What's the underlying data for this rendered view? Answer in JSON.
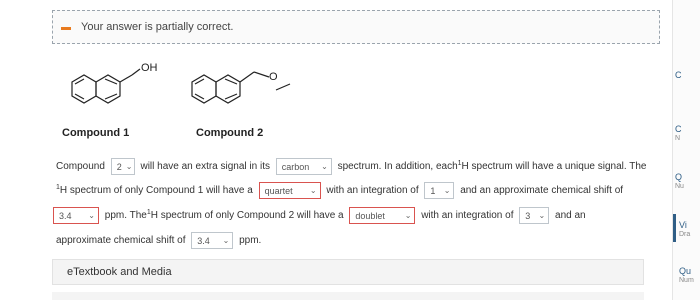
{
  "banner": {
    "message": "Your answer is partially correct."
  },
  "compounds": [
    {
      "label": "Compound 1",
      "substituent": "OH"
    },
    {
      "label": "Compound 2",
      "substituent": "O"
    }
  ],
  "question": {
    "line1_pre": "Compound",
    "compound_select": "2",
    "line1_mid": "will have an extra signal in its",
    "spectrum_select": "carbon",
    "line1_post": "spectrum. In addition, each",
    "h1_sup": "1",
    "line1_end": "H spectrum will have a unique signal. The",
    "line2_pre": "H spectrum of only Compound 1 will have a",
    "mult1_select": "quartet",
    "line2_mid": "with an integration of",
    "integ1_select": "1",
    "line2_post": "and an approximate chemical shift of",
    "shift1_select": "3.4",
    "line3_mid": "ppm. The",
    "line3_mid2": "H spectrum of only Compound 2 will have a",
    "mult2_select": "doublet",
    "line3_post": "with an integration of",
    "integ2_select": "3",
    "line3_end": "and an",
    "line4_pre": "approximate chemical shift of",
    "shift2_select": "3.4",
    "line4_post": "ppm."
  },
  "etextbook": {
    "label": "eTextbook and Media"
  },
  "right_panel": [
    {
      "title": "C",
      "sub": ""
    },
    {
      "title": "C",
      "sub": "N"
    },
    {
      "title": "Q",
      "sub": "Nu"
    },
    {
      "title": "Vi",
      "sub": "Dra"
    },
    {
      "title": "Qu",
      "sub": "Num"
    }
  ],
  "colors": {
    "warning_accent": "#e87a1e",
    "incorrect_border": "#d9534f",
    "link_blue": "#2f5e86"
  }
}
